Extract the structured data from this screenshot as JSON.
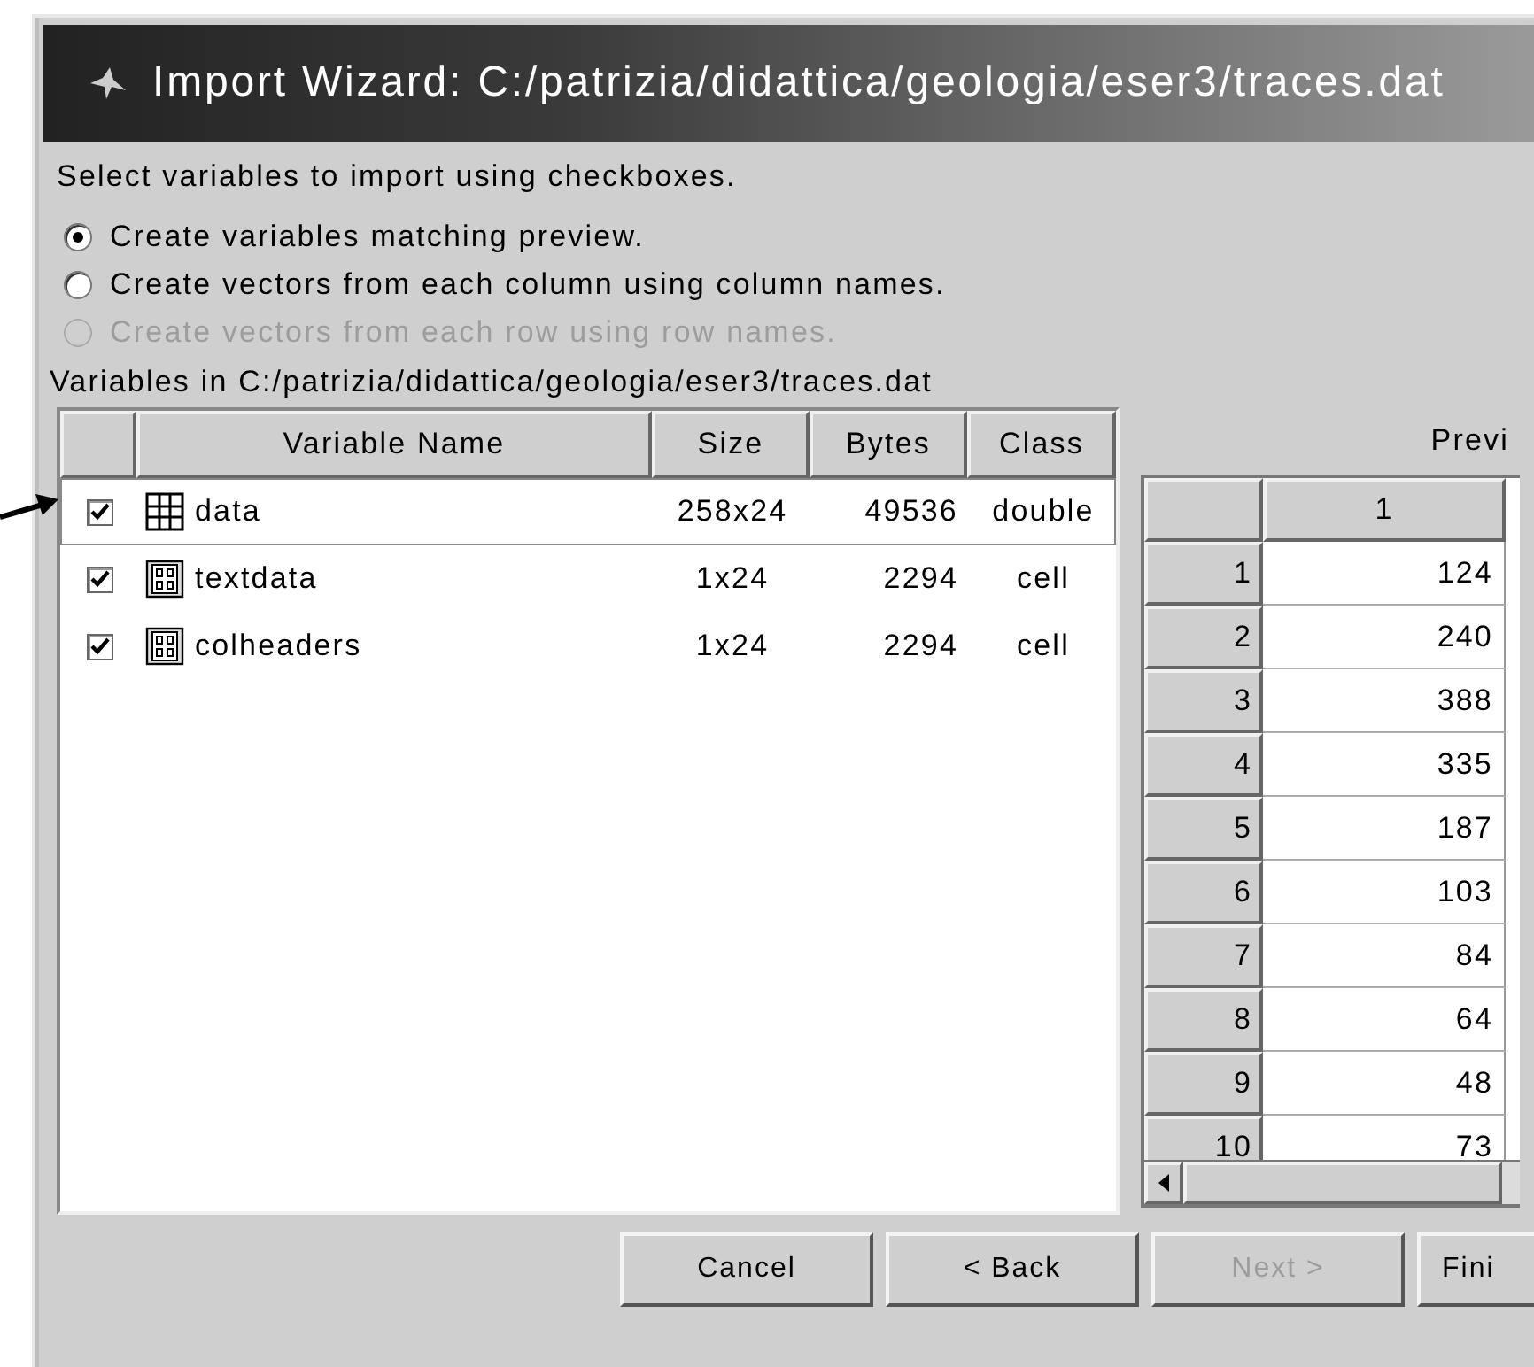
{
  "window": {
    "title": "Import Wizard: C:/patrizia/didattica/geologia/eser3/traces.dat"
  },
  "instruction": "Select variables to import using checkboxes.",
  "options": [
    {
      "label": "Create variables matching preview.",
      "selected": true,
      "disabled": false
    },
    {
      "label": "Create vectors from each column using column names.",
      "selected": false,
      "disabled": false
    },
    {
      "label": "Create vectors from each row using row names.",
      "selected": false,
      "disabled": true
    }
  ],
  "variables_label": "Variables in C:/patrizia/didattica/geologia/eser3/traces.dat",
  "variables_table": {
    "columns": [
      "Variable Name",
      "Size",
      "Bytes",
      "Class"
    ],
    "rows": [
      {
        "checked": true,
        "kind": "matrix",
        "name": "data",
        "size": "258x24",
        "bytes": "49536",
        "class": "double",
        "selected": true
      },
      {
        "checked": true,
        "kind": "cell",
        "name": "textdata",
        "size": "1x24",
        "bytes": "2294",
        "class": "cell",
        "selected": false
      },
      {
        "checked": true,
        "kind": "cell",
        "name": "colheaders",
        "size": "1x24",
        "bytes": "2294",
        "class": "cell",
        "selected": false
      }
    ]
  },
  "preview": {
    "label": "Previ",
    "columns": [
      "1"
    ],
    "rows": [
      {
        "number": "1",
        "value": "124"
      },
      {
        "number": "2",
        "value": "240"
      },
      {
        "number": "3",
        "value": "388"
      },
      {
        "number": "4",
        "value": "335"
      },
      {
        "number": "5",
        "value": "187"
      },
      {
        "number": "6",
        "value": "103"
      },
      {
        "number": "7",
        "value": "84"
      },
      {
        "number": "8",
        "value": "64"
      },
      {
        "number": "9",
        "value": "48"
      },
      {
        "number": "10",
        "value": "73"
      }
    ]
  },
  "buttons": [
    {
      "label": "Cancel",
      "disabled": false
    },
    {
      "label": "< Back",
      "disabled": false
    },
    {
      "label": "Next >",
      "disabled": true
    },
    {
      "label": "Fini",
      "disabled": false
    }
  ]
}
